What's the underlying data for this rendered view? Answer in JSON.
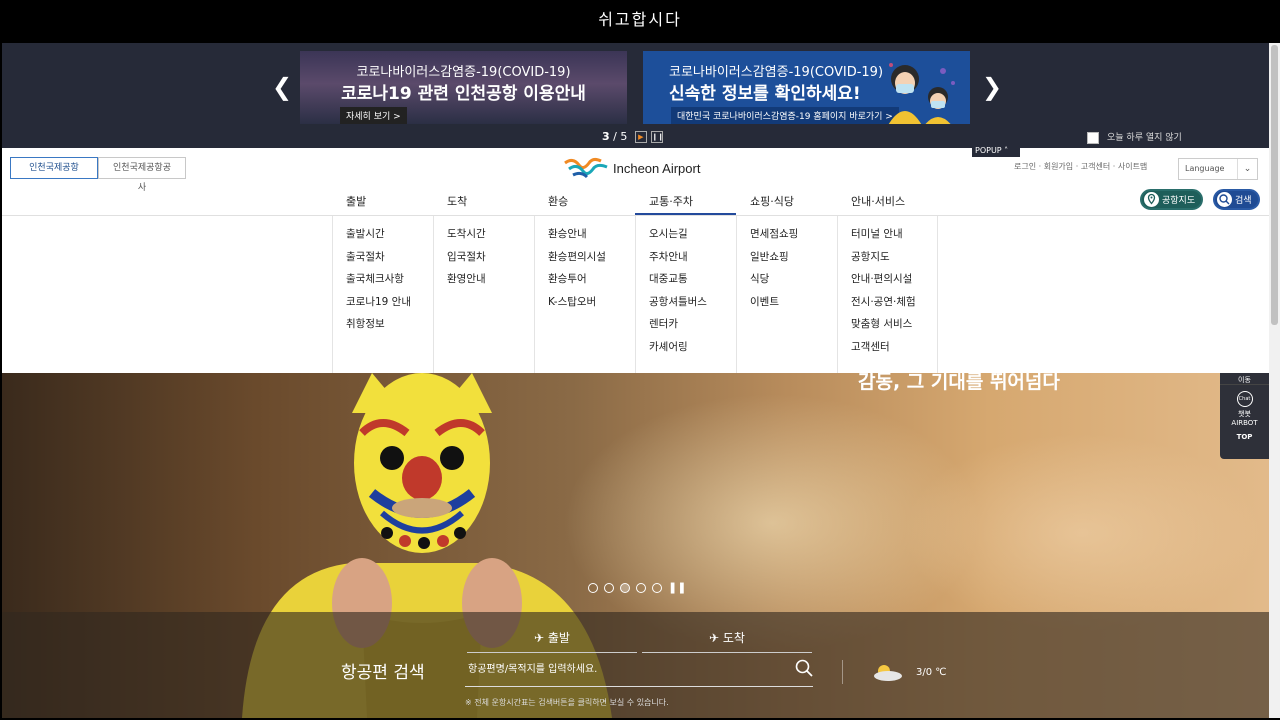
{
  "window": {
    "title": "쉬고합시다"
  },
  "popup": {
    "banners": [
      {
        "line1": "코로나바이러스감염증-19(COVID-19)",
        "line2": "코로나19 관련 인천공항 이용안내",
        "button": "자세히 보기 >"
      },
      {
        "line1": "코로나바이러스감염증-19(COVID-19)",
        "line2": "신속한 정보를 확인하세요!",
        "button": "대한민국 코로나바이러스감염증-19 홈페이지 바로가기 >"
      }
    ],
    "pager_current": "3",
    "pager_sep": " / ",
    "pager_total": "5",
    "no_show_today": "오늘 하루 열지 않기",
    "popup_tab": "POPUP"
  },
  "header": {
    "tab_active": "인천국제공항",
    "tab_inactive": "인천국제공항공사",
    "logo_text": "Incheon Airport",
    "util_links": "로그인 · 회원가입 · 고객센터 · 사이트맵",
    "language": "Language",
    "map_button": "공항지도",
    "search_button": "검색"
  },
  "gnb": [
    "출발",
    "도착",
    "환승",
    "교통·주차",
    "쇼핑·식당",
    "안내·서비스"
  ],
  "mega": [
    [
      "출발시간",
      "출국절차",
      "출국체크사항",
      "코로나19 안내",
      "취항정보"
    ],
    [
      "도착시간",
      "입국절차",
      "환영안내"
    ],
    [
      "환승안내",
      "환승편의시설",
      "환승투어",
      "K-스탑오버"
    ],
    [
      "오시는길",
      "주차안내",
      "대중교통",
      "공항셔틀버스",
      "렌터카",
      "카셰어링"
    ],
    [
      "면세점쇼핑",
      "일반쇼핑",
      "식당",
      "이벤트"
    ],
    [
      "터미널 안내",
      "공항지도",
      "안내·편의시설",
      "전시·공연·체험",
      "맞춤형 서비스",
      "고객센터"
    ]
  ],
  "hero": {
    "headline": "감동, 그 기대를 뛰어넘다",
    "pause": "❚❚"
  },
  "flight_search": {
    "title": "항공편 검색",
    "tab_departure": "출발",
    "tab_arrival": "도착",
    "placeholder": "항공편명/목적지를 입력하세요.",
    "note": "※ 전체 운항시간표는 검색버튼을 클릭하면 보실 수 있습니다.",
    "weather": "3/0 ℃"
  },
  "quickbar": {
    "move": "이동",
    "chat_icon": "Chat",
    "chatbot": "챗봇",
    "airbot": "AIRBOT",
    "top": "TOP"
  }
}
